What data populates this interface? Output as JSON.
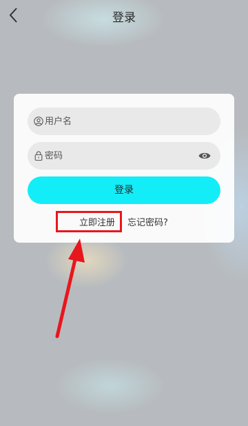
{
  "header": {
    "title": "登录",
    "back_icon": "chevron-left-icon"
  },
  "form": {
    "username": {
      "placeholder": "用户名",
      "value": "",
      "icon": "user-icon"
    },
    "password": {
      "placeholder": "密码",
      "value": "",
      "icon": "lock-icon",
      "toggle_icon": "eye-icon"
    },
    "login_label": "登录",
    "register_label": "立即注册",
    "forgot_label": "忘记密码?"
  },
  "annotation": {
    "highlight_color": "#e8161d",
    "target": "立即注册"
  },
  "colors": {
    "accent": "#13edf7",
    "background": "#b7bbbf"
  }
}
